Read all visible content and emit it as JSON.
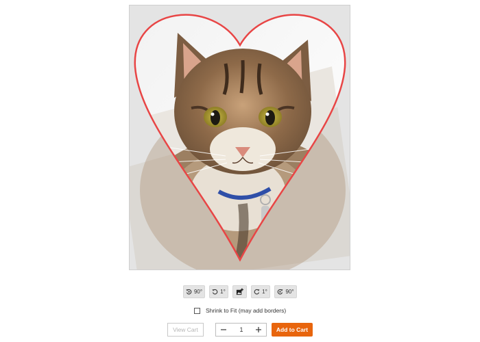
{
  "toolbar": {
    "rotate_left_90": {
      "label": "90°",
      "icon": "rotate-left-icon"
    },
    "rotate_left_1": {
      "label": "1°",
      "icon": "rotate-ccw-fine-icon"
    },
    "replace_image": {
      "icon": "add-image-icon"
    },
    "rotate_right_1": {
      "label": "1°",
      "icon": "rotate-cw-fine-icon"
    },
    "rotate_right_90": {
      "label": "90°",
      "icon": "rotate-right-icon"
    }
  },
  "shrink_to_fit": {
    "label": "Shrink to Fit (may add borders)",
    "checked": false
  },
  "view_cart_label": "View Cart",
  "quantity": {
    "value": "1",
    "minus_icon": "minus-icon",
    "plus_icon": "plus-icon"
  },
  "add_to_cart_label": "Add to Cart",
  "preview": {
    "mask_shape": "heart",
    "outline_color": "#e84545",
    "image_subject": "tabby-cat-photo"
  },
  "colors": {
    "accent": "#e8650d",
    "heart_outline": "#e84545"
  }
}
